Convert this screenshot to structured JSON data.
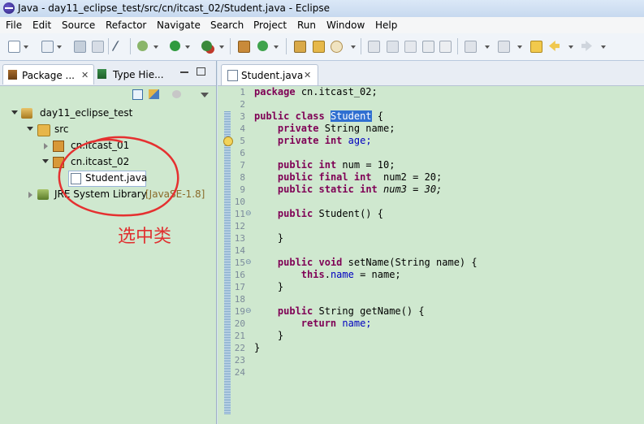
{
  "window": {
    "title": "Java - day11_eclipse_test/src/cn/itcast_02/Student.java - Eclipse"
  },
  "menu": [
    "File",
    "Edit",
    "Source",
    "Refactor",
    "Navigate",
    "Search",
    "Project",
    "Run",
    "Window",
    "Help"
  ],
  "left_panel": {
    "tabs": [
      {
        "label": "Package ..."
      },
      {
        "label": "Type Hie..."
      }
    ],
    "tree": {
      "project": "day11_eclipse_test",
      "src": "src",
      "pkg1": "cn.itcast_01",
      "pkg2": "cn.itcast_02",
      "file": "Student.java",
      "jre": "JRE System Library",
      "jre_version": "[JavaSE-1.8]"
    },
    "annotation": "选中类"
  },
  "editor": {
    "tab_label": "Student.java",
    "line_numbers": [
      "1",
      "2",
      "3",
      "4",
      "5",
      "6",
      "7",
      "8",
      "9",
      "10",
      "11",
      "12",
      "13",
      "14",
      "15",
      "16",
      "17",
      "18",
      "19",
      "20",
      "21",
      "22",
      "23",
      "24"
    ],
    "code": {
      "l1": "cn.itcast_02;",
      "l3_class": "Student",
      "l4": "String name;",
      "l5": "age;",
      "l7": "num = 10;",
      "l8": "num2 = 20;",
      "l9": "num3 = 30;",
      "l11": "Student() {",
      "l13": "}",
      "l15a": "setName(String",
      "l15b": "name) {",
      "l16a": "this",
      "l16b": "name",
      "l16c": " = name;",
      "l17": "}",
      "l19": "String getName() {",
      "l20": "name;",
      "l21": "}",
      "l22": "}"
    }
  }
}
